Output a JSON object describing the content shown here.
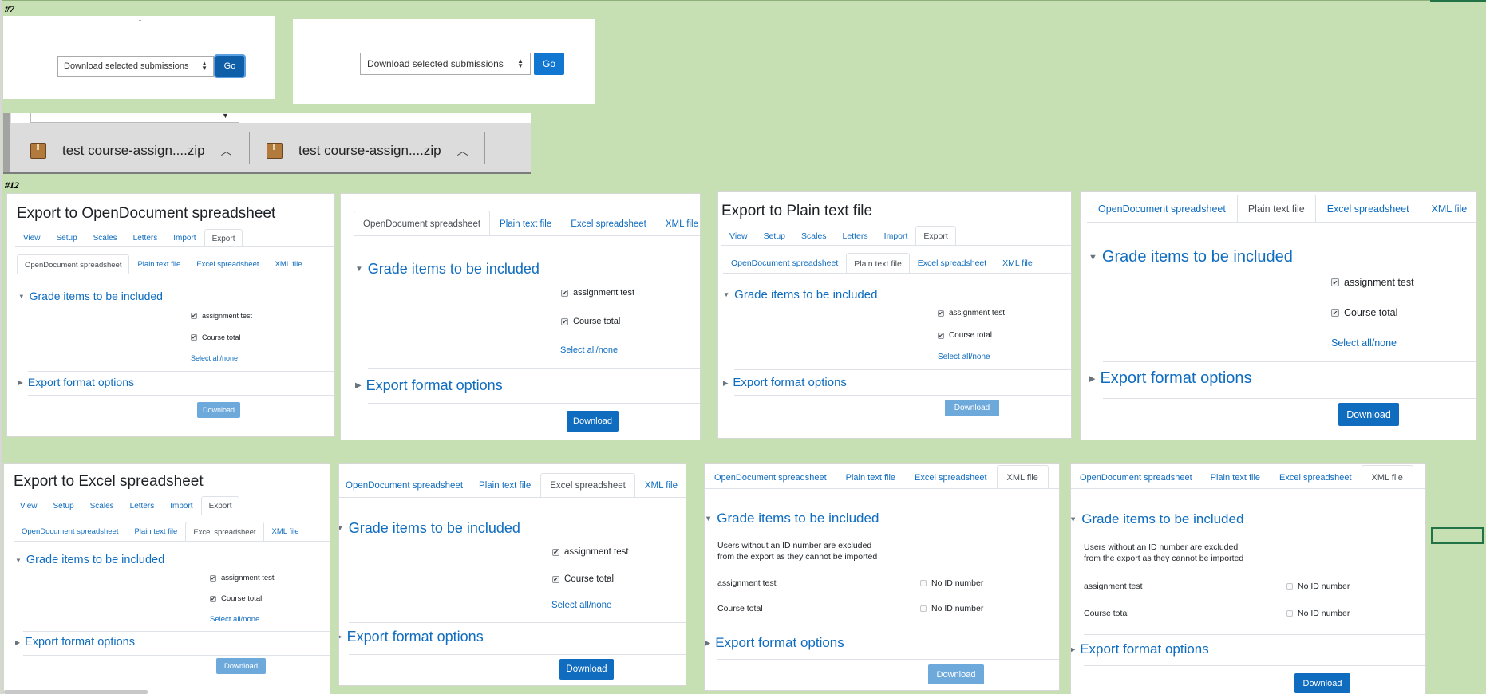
{
  "labels": {
    "s7": "#7",
    "s12": "#12"
  },
  "row7": {
    "select_text": "Download selected submissions",
    "go": "Go",
    "dot": "-"
  },
  "downloads": {
    "item1": "test course-assign....zip",
    "item2": "test course-assign....zip"
  },
  "panels": {
    "p1": {
      "title": "Export to OpenDocument spreadsheet",
      "nav": [
        "View",
        "Setup",
        "Scales",
        "Letters",
        "Import",
        "Export"
      ],
      "formats": [
        "OpenDocument spreadsheet",
        "Plain text file",
        "Excel spreadsheet",
        "XML file"
      ],
      "grade_items": "Grade items to be included",
      "items": [
        "assignment test",
        "Course total"
      ],
      "select_all": "Select all/none",
      "export_options": "Export format options",
      "download": "Download"
    },
    "p2": {
      "formats": [
        "OpenDocument spreadsheet",
        "Plain text file",
        "Excel spreadsheet",
        "XML file"
      ],
      "grade_items": "Grade items to be included",
      "items": [
        "assignment test",
        "Course total"
      ],
      "select_all": "Select all/none",
      "export_options": "Export format options",
      "download": "Download"
    },
    "p3": {
      "title": "Export to Plain text file",
      "nav": [
        "View",
        "Setup",
        "Scales",
        "Letters",
        "Import",
        "Export"
      ],
      "formats": [
        "OpenDocument spreadsheet",
        "Plain text file",
        "Excel spreadsheet",
        "XML file"
      ],
      "grade_items": "Grade items to be included",
      "items": [
        "assignment test",
        "Course total"
      ],
      "select_all": "Select all/none",
      "export_options": "Export format options",
      "download": "Download"
    },
    "p4": {
      "formats": [
        "OpenDocument spreadsheet",
        "Plain text file",
        "Excel spreadsheet",
        "XML file"
      ],
      "grade_items": "Grade items to be included",
      "items": [
        "assignment test",
        "Course total"
      ],
      "select_all": "Select all/none",
      "export_options": "Export format options",
      "download": "Download"
    },
    "p5": {
      "title": "Export to Excel spreadsheet",
      "nav": [
        "View",
        "Setup",
        "Scales",
        "Letters",
        "Import",
        "Export"
      ],
      "formats": [
        "OpenDocument spreadsheet",
        "Plain text file",
        "Excel spreadsheet",
        "XML file"
      ],
      "grade_items": "Grade items to be included",
      "items": [
        "assignment test",
        "Course total"
      ],
      "select_all": "Select all/none",
      "export_options": "Export format options",
      "download": "Download"
    },
    "p6": {
      "formats": [
        "OpenDocument spreadsheet",
        "Plain text file",
        "Excel spreadsheet",
        "XML file"
      ],
      "grade_items": "Grade items to be included",
      "items": [
        "assignment test",
        "Course total"
      ],
      "select_all": "Select all/none",
      "export_options": "Export format options",
      "download": "Download"
    },
    "p7": {
      "formats": [
        "OpenDocument spreadsheet",
        "Plain text file",
        "Excel spreadsheet",
        "XML file"
      ],
      "grade_items": "Grade items to be included",
      "note": [
        "Users without an ID number are excluded",
        "from the export as they cannot be imported"
      ],
      "items": [
        "assignment test",
        "Course total"
      ],
      "no_id": "No ID number",
      "export_options": "Export format options",
      "download": "Download"
    },
    "p8": {
      "formats": [
        "OpenDocument spreadsheet",
        "Plain text file",
        "Excel spreadsheet",
        "XML file"
      ],
      "grade_items": "Grade items to be included",
      "note": [
        "Users without an ID number are excluded",
        "from the export as they cannot be imported"
      ],
      "items": [
        "assignment test",
        "Course total"
      ],
      "no_id": "No ID number",
      "export_options": "Export format options",
      "download": "Download"
    }
  },
  "colors": {
    "sheet_bg": "#c6e0b4",
    "link": "#0f6cbf",
    "button": "#0f6cbf",
    "button_disabled": "#6ea9dc"
  }
}
